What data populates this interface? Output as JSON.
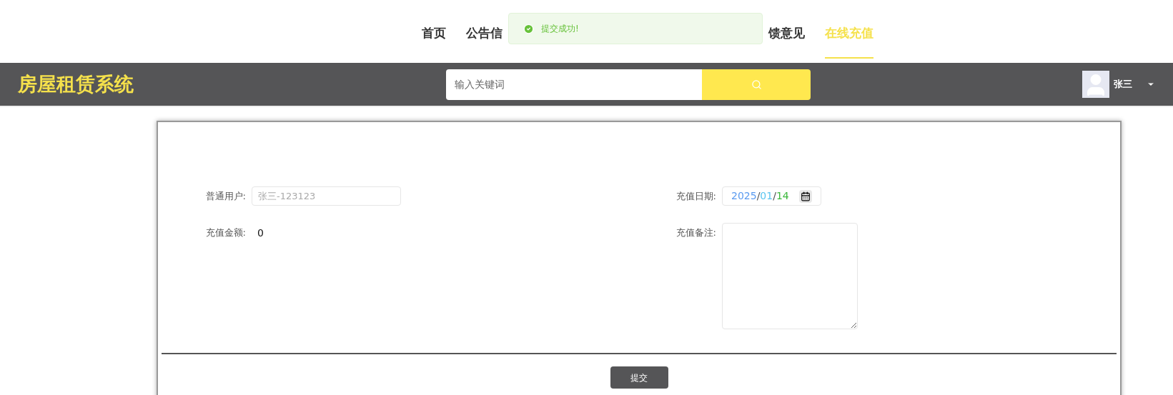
{
  "nav": [
    {
      "label": "首页",
      "selected": false
    },
    {
      "label": "公告信",
      "selected": false
    },
    {
      "label": "馈意见",
      "selected": false
    },
    {
      "label": "在线充值",
      "selected": true
    }
  ],
  "toast": {
    "message": "提交成功!"
  },
  "header": {
    "logo": "房屋租赁系统",
    "search": {
      "placeholder": "输入关键词"
    },
    "user": "张三"
  },
  "form": {
    "left": [
      {
        "label": "普通用户:",
        "kind": "readonly",
        "value": "张三-123123"
      },
      {
        "label": "充值金额:",
        "kind": "text",
        "value": "0"
      }
    ],
    "right": [
      {
        "label": "充值日期:",
        "kind": "date",
        "year": "2025",
        "separator": "/",
        "month": "01",
        "day": "14"
      },
      {
        "label": "充值备注:",
        "kind": "textarea"
      }
    ],
    "submit": "提交"
  }
}
